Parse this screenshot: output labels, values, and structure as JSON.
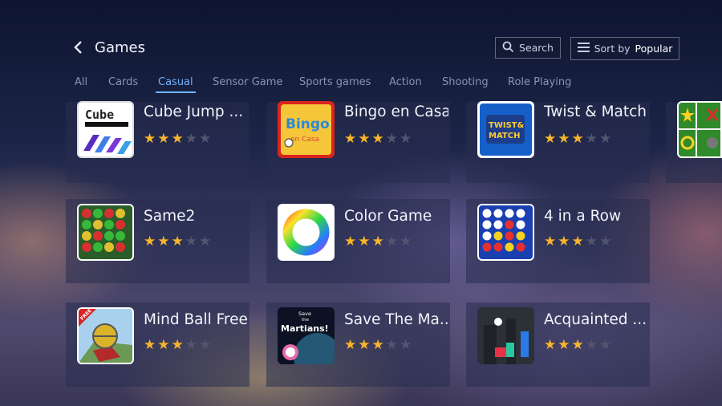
{
  "header": {
    "title": "Games"
  },
  "toolbar": {
    "search_label": "Search",
    "sort_label": "Sort by",
    "sort_value": "Popular"
  },
  "tabs": [
    {
      "label": "All"
    },
    {
      "label": "Cards"
    },
    {
      "label": "Casual",
      "active": true
    },
    {
      "label": "Sensor Game"
    },
    {
      "label": "Sports games"
    },
    {
      "label": "Action"
    },
    {
      "label": "Shooting"
    },
    {
      "label": "Role Playing"
    }
  ],
  "games": [
    {
      "name": "Cube Jump ...",
      "rating": 3,
      "icon": "cube-jump-icon"
    },
    {
      "name": "Bingo en Casa",
      "rating": 3,
      "icon": "bingo-icon"
    },
    {
      "name": "Twist & Match",
      "rating": 3,
      "icon": "twist-match-icon"
    },
    {
      "name": "Same2",
      "rating": 3,
      "icon": "same2-balls-icon"
    },
    {
      "name": "Color Game",
      "rating": 3,
      "icon": "color-wheel-icon"
    },
    {
      "name": "4 in a Row",
      "rating": 3,
      "icon": "four-in-a-row-icon"
    },
    {
      "name": "Mind Ball Free",
      "rating": 3,
      "icon": "mind-ball-icon"
    },
    {
      "name": "Save The Ma...",
      "rating": 3,
      "icon": "save-martians-icon"
    },
    {
      "name": "Acquainted ...",
      "rating": 3,
      "icon": "acquainted-icon"
    }
  ],
  "icon_text": {
    "cube_jump": "Cube",
    "bingo": "Bingo",
    "bingo_sub": "en Casa",
    "twist": "TWIST&",
    "match": "MATCH",
    "free": "FREE",
    "save": "Save",
    "the": "the",
    "martians": "Martians!"
  },
  "colors": {
    "accent": "#6fb3ff",
    "star": "#f7b52a",
    "star_off": "#50566f"
  }
}
